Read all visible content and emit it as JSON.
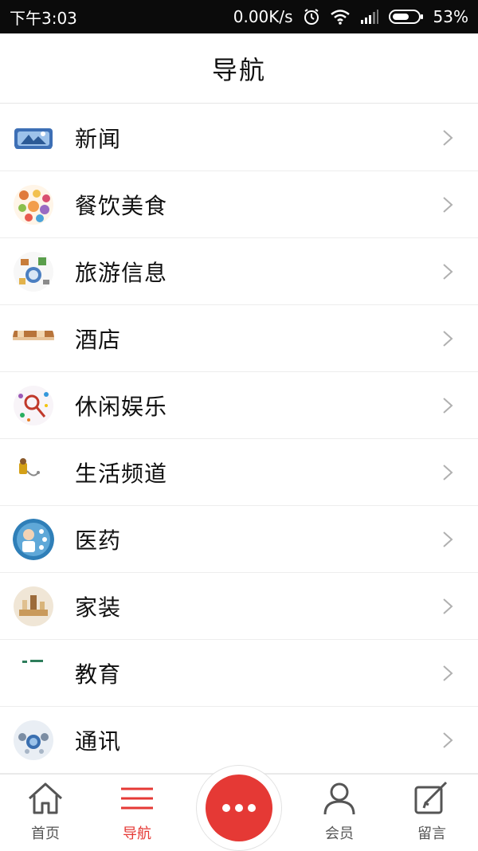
{
  "status_bar": {
    "time": "下午3:03",
    "network_speed": "0.00K/s",
    "battery": "53%",
    "icons": [
      "alarm-icon",
      "wifi-icon",
      "signal-icon",
      "battery-icon"
    ]
  },
  "header": {
    "title": "导航"
  },
  "list": {
    "items": [
      {
        "label": "新闻",
        "icon": "news-thumbnail"
      },
      {
        "label": "餐饮美食",
        "icon": "food-thumbnail"
      },
      {
        "label": "旅游信息",
        "icon": "travel-thumbnail"
      },
      {
        "label": "酒店",
        "icon": "hotel-thumbnail"
      },
      {
        "label": "休闲娱乐",
        "icon": "leisure-thumbnail"
      },
      {
        "label": "生活频道",
        "icon": "life-thumbnail"
      },
      {
        "label": "医药",
        "icon": "medicine-thumbnail"
      },
      {
        "label": "家装",
        "icon": "home-decor-thumbnail"
      },
      {
        "label": "教育",
        "icon": "education-thumbnail"
      },
      {
        "label": "通讯",
        "icon": "communication-thumbnail"
      }
    ],
    "chevron_icon": "chevron-right-icon"
  },
  "bottom_nav": {
    "items": [
      {
        "label": "首页",
        "icon": "home-icon",
        "active": false
      },
      {
        "label": "导航",
        "icon": "menu-icon",
        "active": true
      },
      {
        "label": "会员",
        "icon": "user-icon",
        "active": false
      },
      {
        "label": "留言",
        "icon": "edit-icon",
        "active": false
      }
    ],
    "center_button_icon": "more-dots-icon"
  },
  "colors": {
    "accent": "#e53935",
    "status_bar_bg": "#0b0b0b",
    "divider": "#ededed",
    "inactive": "#555555",
    "chevron": "#b0b0b0"
  }
}
